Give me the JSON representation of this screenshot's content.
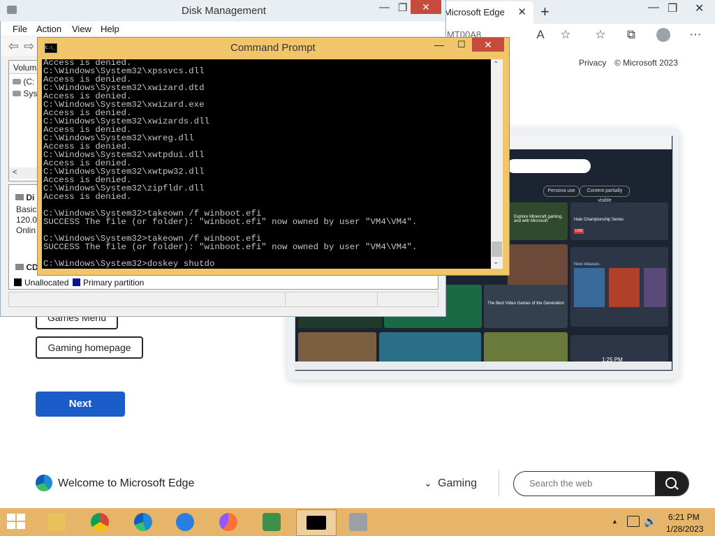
{
  "edge": {
    "tab_title": "Microsoft Edge",
    "tab_close": "✕",
    "new_tab": "+",
    "url_fragment": "MT00A8",
    "privacy": "Privacy",
    "copyright": "© Microsoft 2023",
    "games_menu": "Games Menu",
    "gaming_homepage": "Gaming homepage",
    "next": "Next",
    "welcome": "Welcome to Microsoft Edge",
    "gaming_chevron": "⌄",
    "gaming": "Gaming",
    "search_placeholder": "Search the web",
    "minimize": "—",
    "restore": "❐",
    "close": "✕",
    "read_aloud": "A",
    "favorites_add": "☆",
    "favorites": "☆",
    "collections": "⧉",
    "more": "⋯",
    "preview": {
      "chip1": "Persona use",
      "chip2": "Content partially visible",
      "tournament": "Halo Championship Series",
      "live": "LIVE",
      "best_games": "The Best Video Games of the Generation",
      "new_releases": "New releases",
      "minecraft": "Explore Minecraft gaming, and with Microsoft",
      "time": "1:25 PM"
    }
  },
  "disk_mgmt": {
    "title": "Disk Management",
    "menu": [
      "File",
      "Action",
      "View",
      "Help"
    ],
    "back": "⇦",
    "forward": "⇨",
    "col_volume": "Volum",
    "rows": [
      "(C:",
      "Syst"
    ],
    "scroll_left": "<",
    "disk_label": "Di",
    "disk_type": "Basic",
    "disk_size": "120.0",
    "disk_status": "Onlin",
    "cd_label": "CD",
    "legend_unallocated": "Unallocated",
    "legend_primary": "Primary partition",
    "colors": {
      "unallocated": "#000000",
      "primary": "#0b1593"
    }
  },
  "cmd": {
    "title": "Command Prompt",
    "icon_text": "C:\\_",
    "minimize": "—",
    "maximize": "☐",
    "close": "✕",
    "scroll_up": "⌃",
    "scroll_down": "⌄",
    "lines": [
      "Access is denied.",
      "C:\\Windows\\System32\\xpssvcs.dll",
      "Access is denied.",
      "C:\\Windows\\System32\\xwizard.dtd",
      "Access is denied.",
      "C:\\Windows\\System32\\xwizard.exe",
      "Access is denied.",
      "C:\\Windows\\System32\\xwizards.dll",
      "Access is denied.",
      "C:\\Windows\\System32\\xwreg.dll",
      "Access is denied.",
      "C:\\Windows\\System32\\xwtpdui.dll",
      "Access is denied.",
      "C:\\Windows\\System32\\xwtpw32.dll",
      "Access is denied.",
      "C:\\Windows\\System32\\zipfldr.dll",
      "Access is denied.",
      "",
      "C:\\Windows\\System32>takeown /f winboot.efi",
      "SUCCESS The file (or folder): \"winboot.efi\" now owned by user \"VM4\\VM4\".",
      "",
      "C:\\Windows\\System32>takeown /f winboot.efi",
      "SUCCESS The file (or folder): \"winboot.efi\" now owned by user \"VM4\\VM4\".",
      "",
      "C:\\Windows\\System32>doskey shutdo"
    ]
  },
  "taskbar": {
    "apps": [
      "file-explorer",
      "chrome",
      "edge",
      "internet-explorer",
      "firefox",
      "people",
      "command-prompt",
      "disk-management"
    ],
    "tray_up": "▲",
    "volume": "🔊",
    "time": "6:21 PM",
    "date": "1/28/2023",
    "colors": {
      "bar": "#e6b56a"
    }
  }
}
